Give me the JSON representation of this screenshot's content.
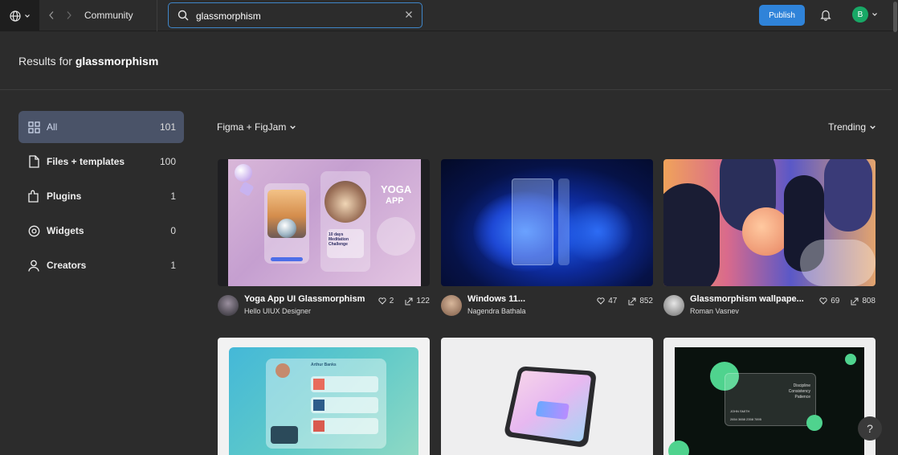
{
  "topbar": {
    "breadcrumb": "Community",
    "search": {
      "value": "glassmorphism",
      "placeholder": ""
    },
    "publish_label": "Publish",
    "avatar_initial": "B"
  },
  "results": {
    "prefix": "Results for",
    "query": "glassmorphism"
  },
  "sidebar": {
    "items": [
      {
        "label": "All",
        "count": "101",
        "icon": "grid-icon",
        "active": true
      },
      {
        "label": "Files + templates",
        "count": "100",
        "icon": "file-icon",
        "active": false
      },
      {
        "label": "Plugins",
        "count": "1",
        "icon": "plugin-icon",
        "active": false
      },
      {
        "label": "Widgets",
        "count": "0",
        "icon": "widget-icon",
        "active": false
      },
      {
        "label": "Creators",
        "count": "1",
        "icon": "user-icon",
        "active": false
      }
    ]
  },
  "filters": {
    "product": "Figma + FigJam",
    "sort": "Trending"
  },
  "cards": [
    {
      "title": "Yoga App UI Glassmorphism",
      "author": "Hello UIUX Designer",
      "likes": "2",
      "uses": "122"
    },
    {
      "title": "Windows 11...",
      "author": "Nagendra Bathala",
      "likes": "47",
      "uses": "852"
    },
    {
      "title": "Glassmorphism wallpape...",
      "author": "Roman Vasnev",
      "likes": "69",
      "uses": "808"
    }
  ],
  "thumbs": {
    "yoga_big": "YOGA",
    "yoga_small": "APP",
    "yoga_caption": "10 days Meditation Challenge",
    "profile_name": "Arthur Banks",
    "card_name": "JOHN SMITH",
    "card_number": "2654 3658 2358 7895",
    "card_words": [
      "Discipline",
      "Consistency",
      "Patience"
    ]
  },
  "colors": {
    "accent": "#2f83d9",
    "active_bg": "#4a5368",
    "avatar": "#18a866"
  }
}
